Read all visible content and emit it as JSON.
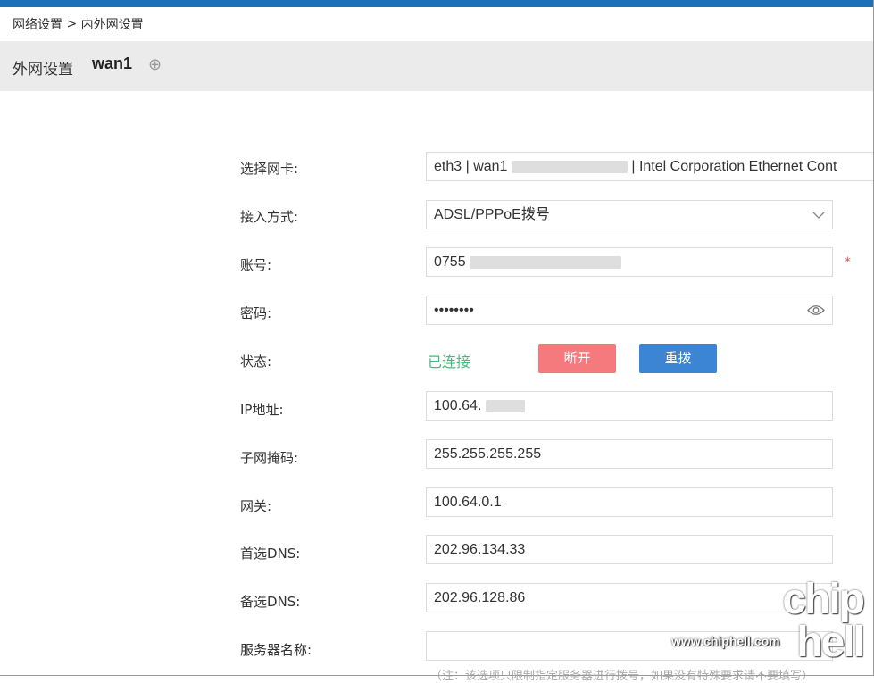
{
  "breadcrumb": {
    "parent": "网络设置",
    "sep": ">",
    "current": "内外网设置"
  },
  "header": {
    "title": "外网设置",
    "name": "wan1",
    "add_icon": "⊕"
  },
  "form": {
    "nic": {
      "label": "选择网卡:",
      "value_prefix": "eth3 | wan1",
      "value_suffix": "| Intel Corporation Ethernet Cont"
    },
    "access": {
      "label": "接入方式:",
      "value": "ADSL/PPPoE拨号"
    },
    "account": {
      "label": "账号:",
      "value": "0755",
      "required": "*"
    },
    "password": {
      "label": "密码:",
      "value": "••••••••"
    },
    "status": {
      "label": "状态:",
      "value": "已连接",
      "disconnect": "断开",
      "redial": "重拨"
    },
    "ip": {
      "label": "IP地址:",
      "value": "100.64."
    },
    "mask": {
      "label": "子网掩码:",
      "value": "255.255.255.255"
    },
    "gateway": {
      "label": "网关:",
      "value": "100.64.0.1"
    },
    "dns1": {
      "label": "首选DNS:",
      "value": "202.96.134.33"
    },
    "dns2": {
      "label": "备选DNS:",
      "value": "202.96.128.86"
    },
    "server": {
      "label": "服务器名称:",
      "value": ""
    }
  },
  "note": "（注：该选项只限制指定服务器进行拨号，如果没有特殊要求请不要填写）",
  "watermark": {
    "logo_top": "chip",
    "logo_bottom": "hell",
    "url": "www.chiphell.com"
  },
  "colors": {
    "accent": "#1d6fb8",
    "success": "#3bbf7a",
    "danger": "#f57a7e",
    "primary": "#3b85d4"
  }
}
